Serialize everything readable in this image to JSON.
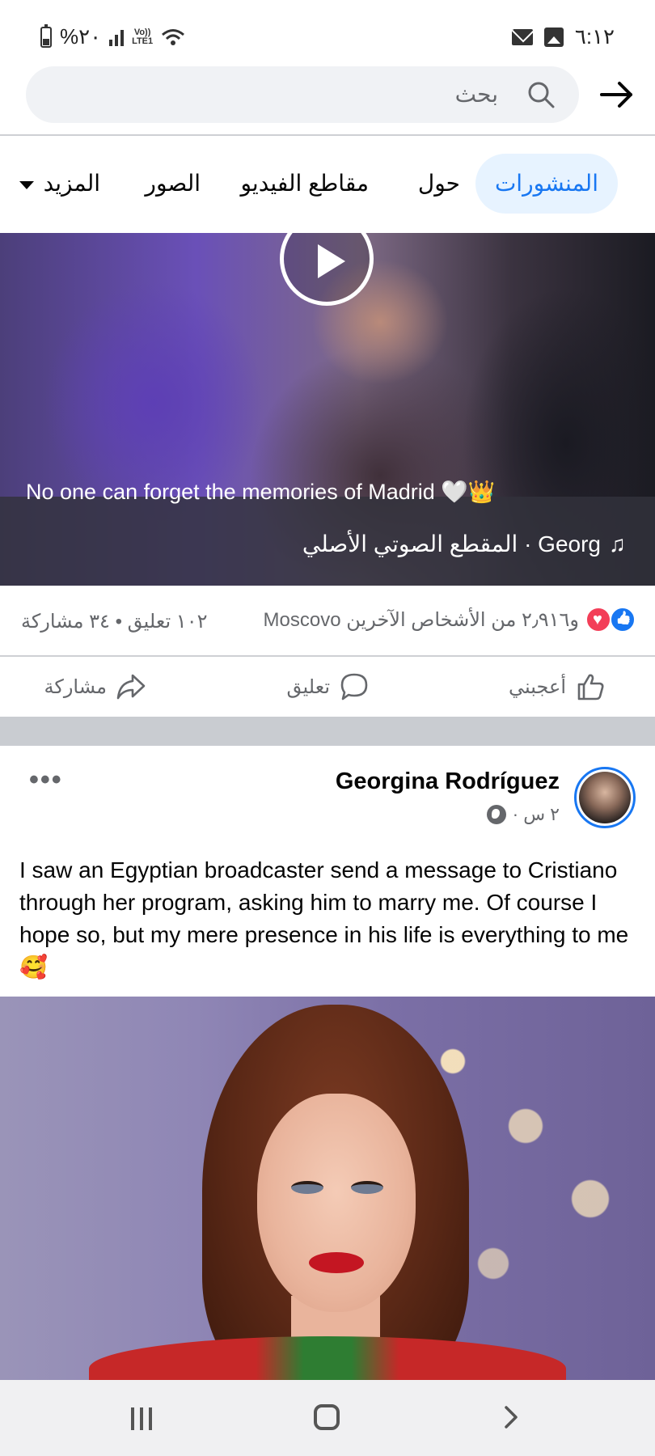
{
  "status_bar": {
    "battery_percent": "%٢٠",
    "network_label_top": "Vo))",
    "network_label_bottom": "LTE1",
    "time": "٦:١٢"
  },
  "search": {
    "placeholder": "بحث"
  },
  "tabs": [
    {
      "label": "المنشورات",
      "active": true
    },
    {
      "label": "حول",
      "active": false
    },
    {
      "label": "مقاطع الفيديو",
      "active": false
    },
    {
      "label": "الصور",
      "active": false
    },
    {
      "label": "المزيد",
      "active": false
    }
  ],
  "video_post": {
    "caption": "No one can forget the memories of Madrid 🤍👑",
    "audio_line": "Georg · المقطع الصوتي الأصلي",
    "reactions_summary": "و٢٫٩١٦ من الأشخاص الآخرين Moscovo",
    "counts": "١٠٢ تعليق • ٣٤ مشاركة",
    "actions": {
      "like": "أعجبني",
      "comment": "تعليق",
      "share": "مشاركة"
    }
  },
  "post": {
    "author": "Georgina Rodríguez",
    "meta": "٢ س ·",
    "text": "I saw an Egyptian broadcaster send a message to Cristiano through her program, asking him to marry me. Of course I hope so, but my mere presence in his life is everything to me 🥰"
  },
  "colors": {
    "accent": "#1877f2",
    "active_tab_bg": "#e7f3ff",
    "secondary_text": "#65676b",
    "love": "#f33e58"
  }
}
